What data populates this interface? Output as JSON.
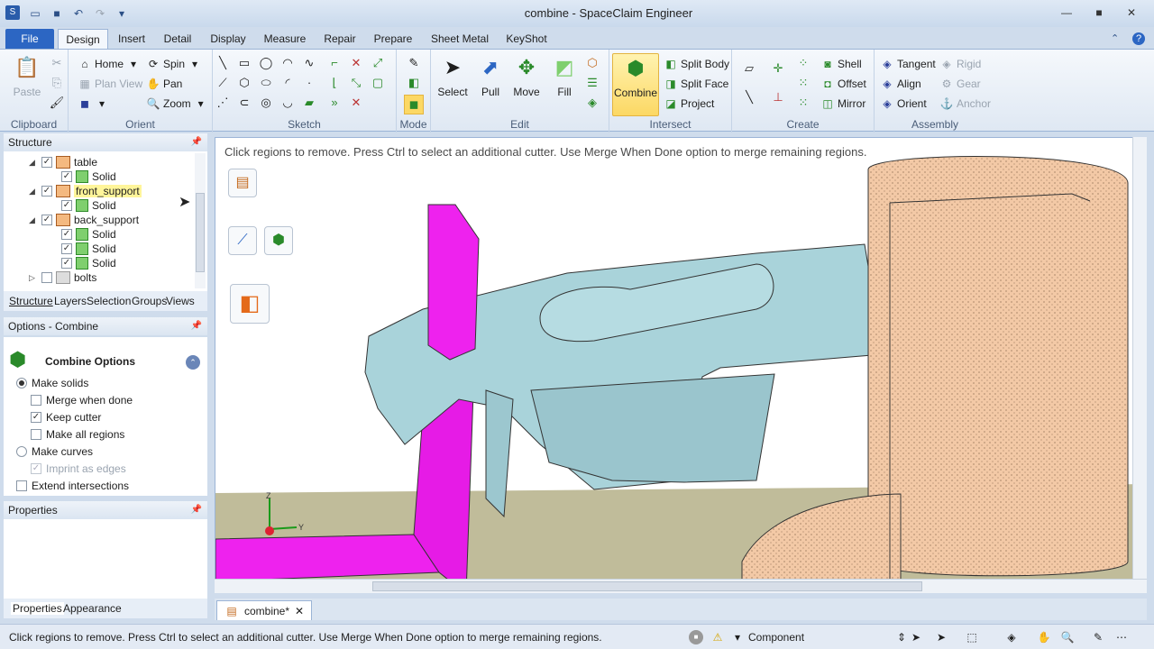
{
  "window": {
    "title": "combine - SpaceClaim Engineer",
    "minimize": "—",
    "maximize": "■",
    "close": "✕",
    "help": "?",
    "ribbon_min": "⌃"
  },
  "tabs": [
    "File",
    "Design",
    "Insert",
    "Detail",
    "Display",
    "Measure",
    "Repair",
    "Prepare",
    "Sheet Metal",
    "KeyShot"
  ],
  "ribbon": {
    "clipboard": {
      "label": "Clipboard",
      "paste": "Paste"
    },
    "orient": {
      "label": "Orient",
      "home": "Home",
      "spin": "Spin",
      "plan_view": "Plan View",
      "pan": "Pan",
      "zoom": "Zoom"
    },
    "sketch": {
      "label": "Sketch"
    },
    "mode": {
      "label": "Mode"
    },
    "edit": {
      "label": "Edit",
      "select": "Select",
      "pull": "Pull",
      "move": "Move",
      "fill": "Fill"
    },
    "intersect": {
      "label": "Intersect",
      "combine": "Combine",
      "split_body": "Split Body",
      "split_face": "Split Face",
      "project": "Project"
    },
    "create": {
      "label": "Create",
      "shell": "Shell",
      "offset": "Offset",
      "mirror": "Mirror"
    },
    "assembly": {
      "label": "Assembly",
      "tangent": "Tangent",
      "align": "Align",
      "orient": "Orient",
      "rigid": "Rigid",
      "gear": "Gear",
      "anchor": "Anchor"
    }
  },
  "structure": {
    "title": "Structure",
    "rows": [
      {
        "label": "table",
        "type": "component",
        "checked": true
      },
      {
        "label": "Solid",
        "type": "body",
        "checked": true
      },
      {
        "label": "front_support",
        "type": "component",
        "checked": true
      },
      {
        "label": "Solid",
        "type": "body",
        "checked": true
      },
      {
        "label": "back_support",
        "type": "component",
        "checked": true
      },
      {
        "label": "Solid",
        "type": "body",
        "checked": true
      },
      {
        "label": "Solid",
        "type": "body",
        "checked": true
      },
      {
        "label": "Solid",
        "type": "body",
        "checked": true
      },
      {
        "label": "bolts",
        "type": "component",
        "checked": false
      }
    ],
    "subtabs": [
      "Structure",
      "Layers",
      "Selection",
      "Groups",
      "Views"
    ]
  },
  "options": {
    "title": "Options - Combine",
    "heading": "Combine Options",
    "make_solids": "Make solids",
    "merge_when_done": "Merge when done",
    "keep_cutter": "Keep cutter",
    "make_all_regions": "Make all regions",
    "make_curves": "Make curves",
    "imprint_as_edges": "Imprint as edges",
    "extend_intersections": "Extend intersections"
  },
  "properties": {
    "title": "Properties",
    "tabs": [
      "Properties",
      "Appearance"
    ]
  },
  "viewport": {
    "message": "Click regions to remove. Press Ctrl to select an additional cutter. Use Merge When Done option to merge remaining regions.",
    "axis_z": "Z",
    "axis_y": "Y"
  },
  "document_tab": {
    "label": "combine*",
    "close": "✕"
  },
  "status": {
    "message": "Click regions to remove. Press Ctrl to select an additional cutter. Use Merge When Done option to merge remaining regions.",
    "component": "Component"
  },
  "colors": {
    "accent": "#2c66c3",
    "part_cyan": "#a9d3da",
    "part_magenta": "#ee22ee",
    "cutter_tan": "#f3c9a6",
    "floor": "#c0bc9a"
  }
}
